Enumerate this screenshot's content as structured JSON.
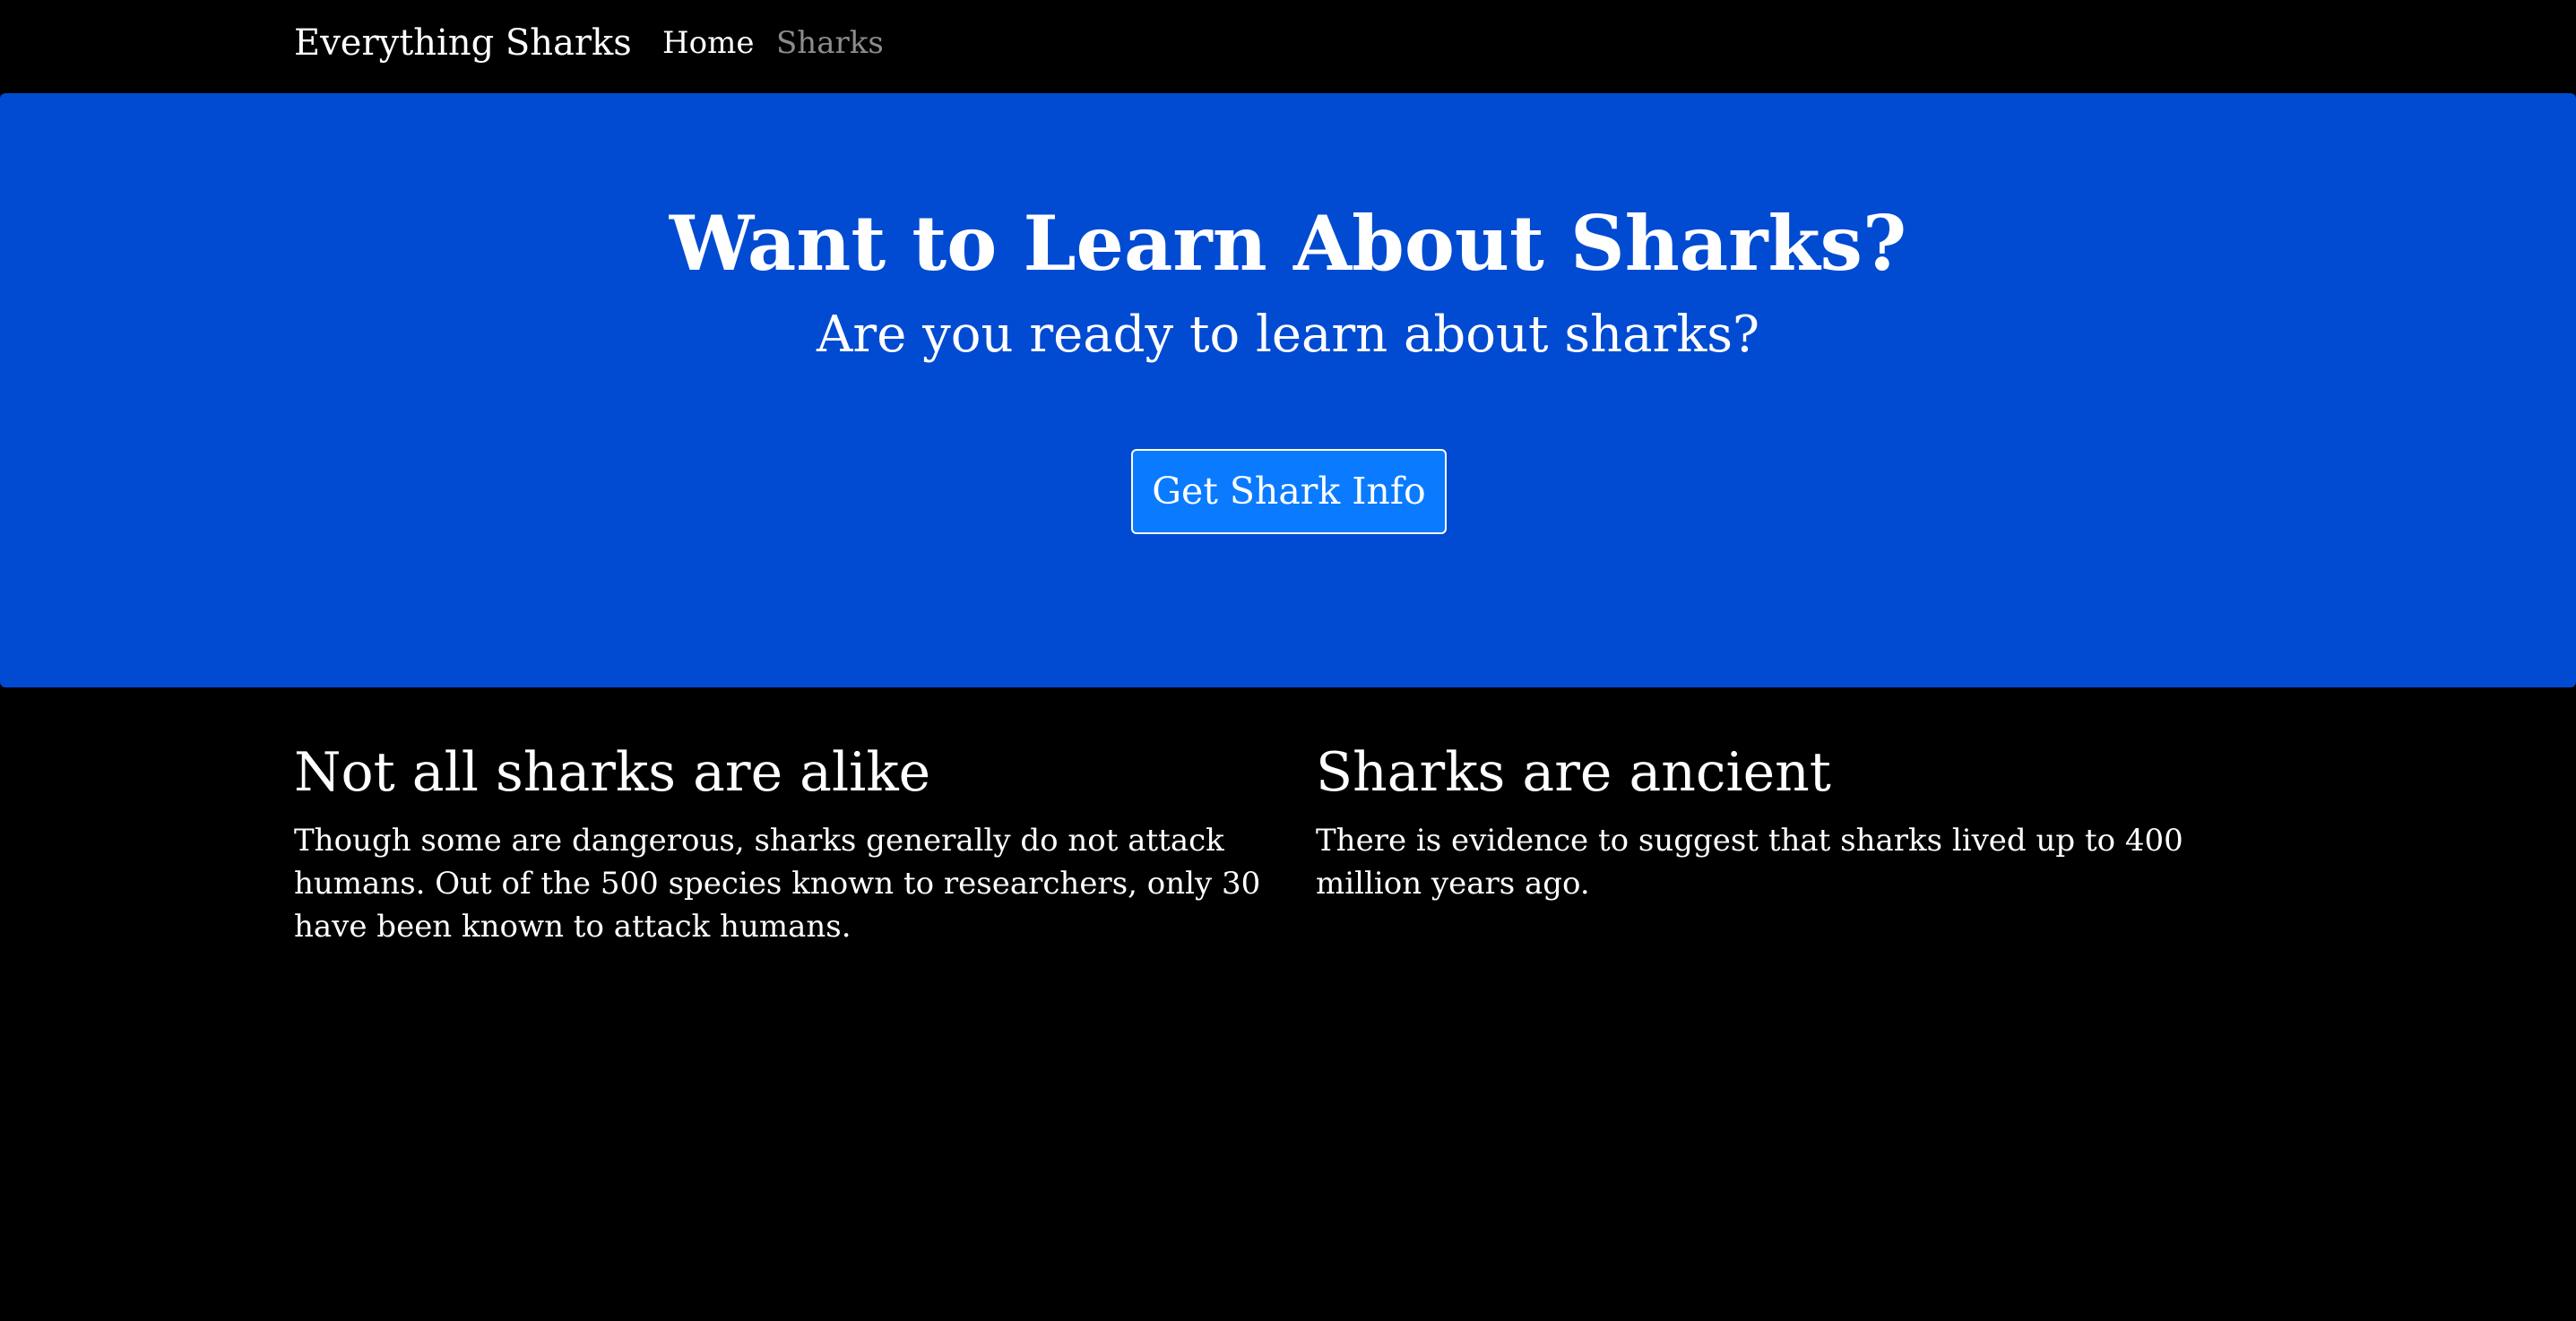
{
  "navbar": {
    "brand": "Everything Sharks",
    "links": [
      {
        "label": "Home",
        "active": true
      },
      {
        "label": "Sharks",
        "active": false
      }
    ]
  },
  "hero": {
    "title": "Want to Learn About Sharks?",
    "subtitle": "Are you ready to learn about sharks?",
    "button_label": "Get Shark Info"
  },
  "features": [
    {
      "heading": "Not all sharks are alike",
      "text": "Though some are dangerous, sharks generally do not attack humans. Out of the 500 species known to researchers, only 30 have been known to attack humans."
    },
    {
      "heading": "Sharks are ancient",
      "text": "There is evidence to suggest that sharks lived up to 400 million years ago."
    }
  ],
  "colors": {
    "page_background": "#000000",
    "hero_background": "#004bd1",
    "button_background": "#0a7bff",
    "text": "#ffffff",
    "inactive_link": "#8c8c8c"
  }
}
